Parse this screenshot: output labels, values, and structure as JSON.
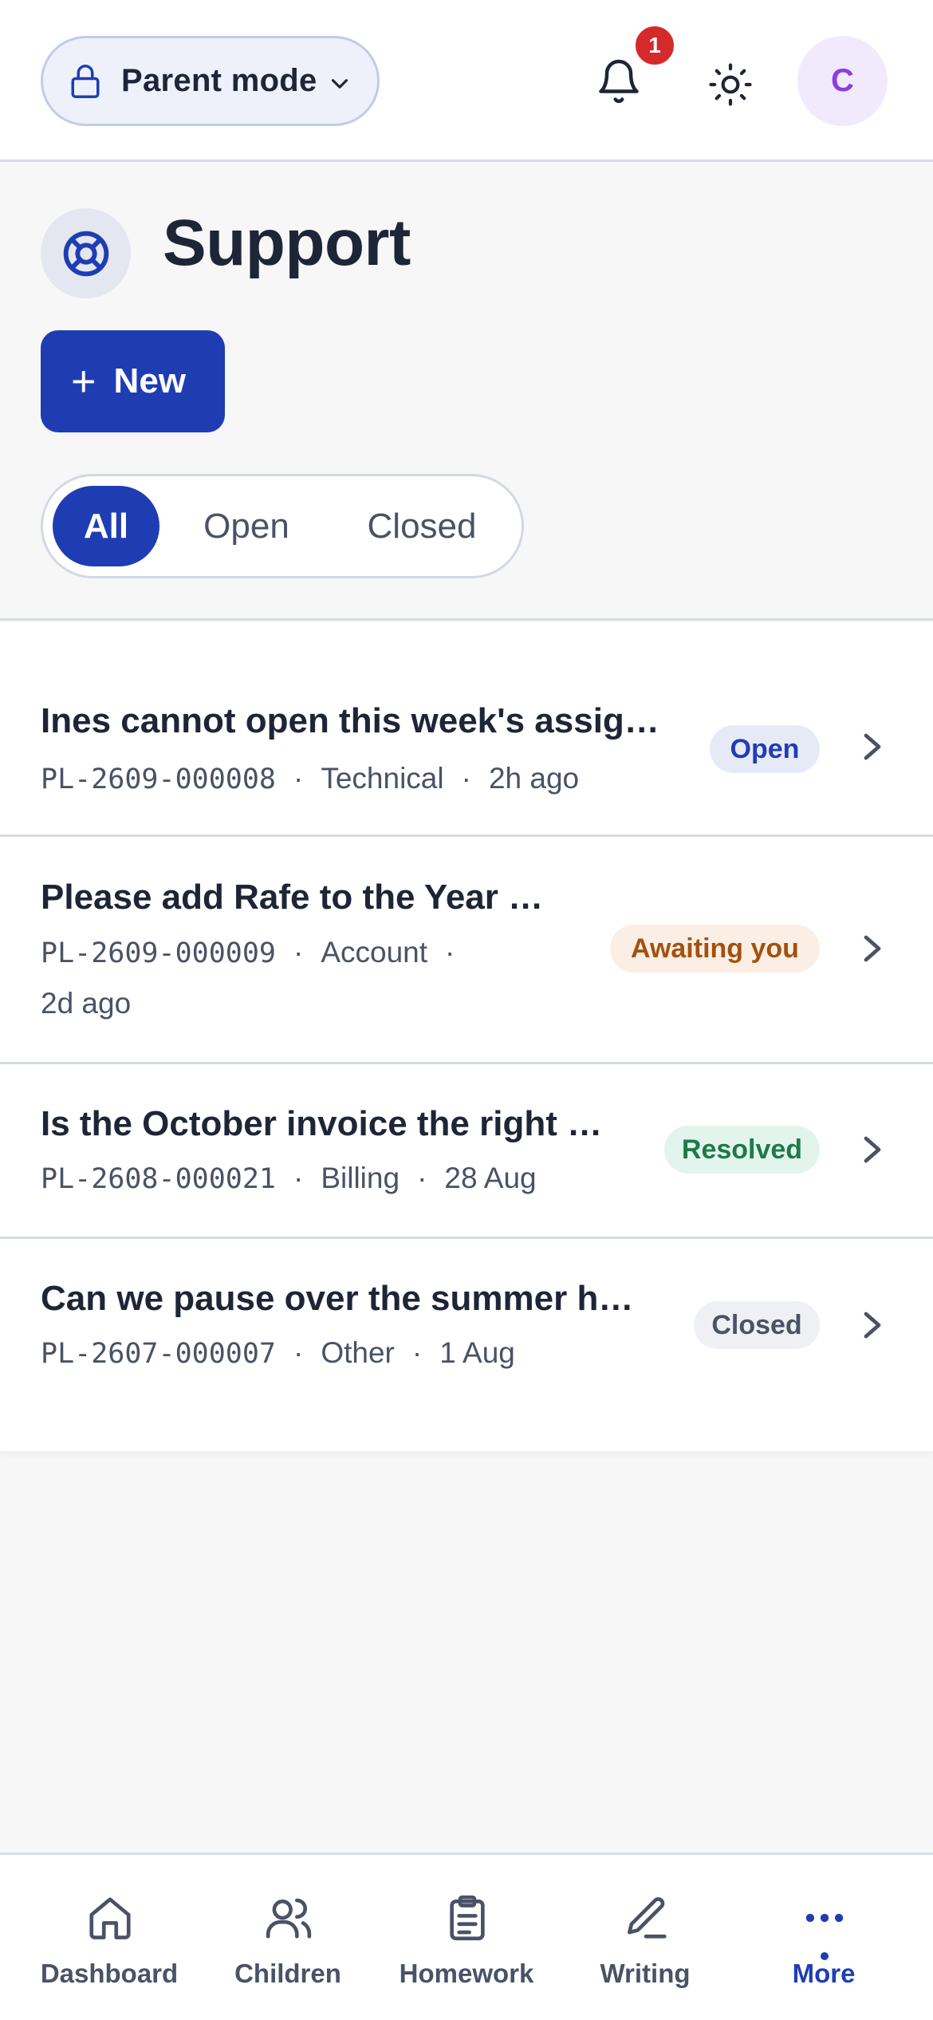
{
  "topbar": {
    "mode_label": "Parent mode",
    "notification_count": "1",
    "avatar_initial": "C"
  },
  "header": {
    "title": "Support",
    "new_button_label": "New",
    "filters": [
      "All",
      "Open",
      "Closed"
    ],
    "active_filter": "All"
  },
  "tickets": [
    {
      "title": "Ines cannot open this week's assig…",
      "code": "PL-2609-000008",
      "category": "Technical",
      "time": "2h ago",
      "status": "Open",
      "status_bg": "#e6eaf6",
      "status_color": "#1f3db3"
    },
    {
      "title": "Please add Rafe to the Year …",
      "code": "PL-2609-000009",
      "category": "Account",
      "time": "2d ago",
      "status": "Awaiting you",
      "status_bg": "#fbeee4",
      "status_color": "#a3510f"
    },
    {
      "title": "Is the October invoice the right …",
      "code": "PL-2608-000021",
      "category": "Billing",
      "time": "28 Aug",
      "status": "Resolved",
      "status_bg": "#e3f4ec",
      "status_color": "#1c7a4a"
    },
    {
      "title": "Can we pause over the summer h…",
      "code": "PL-2607-000007",
      "category": "Other",
      "time": "1 Aug",
      "status": "Closed",
      "status_bg": "#eef0f4",
      "status_color": "#4a5266"
    }
  ],
  "bottom_nav": {
    "items": [
      {
        "label": "Dashboard",
        "icon": "home-icon"
      },
      {
        "label": "Children",
        "icon": "users-icon"
      },
      {
        "label": "Homework",
        "icon": "clipboard-icon"
      },
      {
        "label": "Writing",
        "icon": "pen-icon"
      },
      {
        "label": "More",
        "icon": "more-icon"
      }
    ],
    "active": "More"
  },
  "colors": {
    "primary": "#1f3db3",
    "badge_red": "#d42a2a",
    "avatar_purple": "#8a3ce6"
  }
}
